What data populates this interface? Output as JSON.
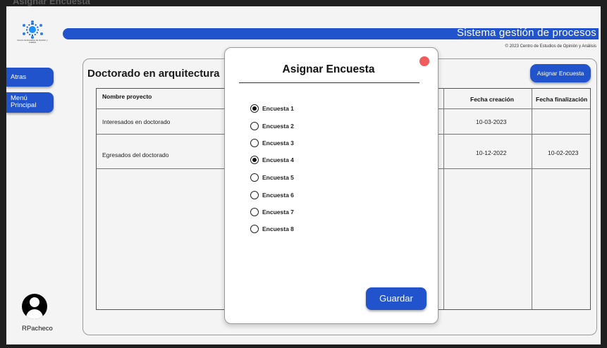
{
  "window": {
    "title": "Asignar Encuesta"
  },
  "logo": {
    "caption": "Centro de Estudios de Opinión y Análisis"
  },
  "header": {
    "title": "Sistema gestión de procesos",
    "copyright": "© 2023 Centro de Estudios de Opinión y Análisis"
  },
  "sidebar": {
    "back_label": "Atras",
    "menu_label_line1": "Menú",
    "menu_label_line2": "Principal"
  },
  "user": {
    "name": "RPacheco",
    "avatar_icon": "user-icon"
  },
  "main": {
    "title": "Doctorado en arquitectura",
    "assign_button": "Asignar Encuesta"
  },
  "table": {
    "columns": [
      "Nombre proyecto",
      "Fecha creación",
      "Fecha finalización"
    ],
    "rows": [
      {
        "name": "Interesados en doctorado",
        "created": "10-03-2023",
        "finished": ""
      },
      {
        "name": "Egresados del doctorado",
        "created": "10-12-2022",
        "finished": "10-02-2023"
      }
    ]
  },
  "modal": {
    "title": "Asignar Encuesta",
    "close_color": "#ee5c5c",
    "options": [
      {
        "label": "Encuesta 1",
        "checked": true
      },
      {
        "label": "Encuesta 2",
        "checked": false
      },
      {
        "label": "Encuesta 3",
        "checked": false
      },
      {
        "label": "Encuesta 4",
        "checked": true
      },
      {
        "label": "Encuesta 5",
        "checked": false
      },
      {
        "label": "Encuesta 6",
        "checked": false
      },
      {
        "label": "Encuesta 7",
        "checked": false
      },
      {
        "label": "Encuesta 8",
        "checked": false
      }
    ],
    "save_button": "Guardar"
  },
  "colors": {
    "accent": "#2154cc",
    "background": "#f4f4f4"
  }
}
